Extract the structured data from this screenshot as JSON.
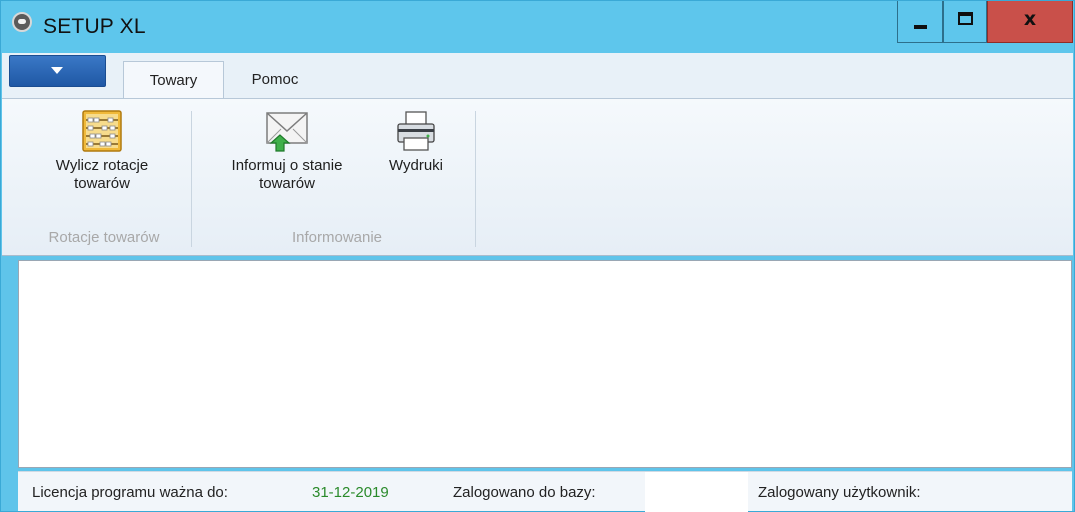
{
  "window": {
    "title": "SETUP XL",
    "close_glyph": "x"
  },
  "tabs": [
    {
      "label": "Towary",
      "active": true
    },
    {
      "label": "Pomoc",
      "active": false
    }
  ],
  "ribbon": {
    "groups": [
      {
        "label": "Rotacje towarów",
        "buttons": [
          {
            "label_line1": "Wylicz rotacje",
            "label_line2": "towarów",
            "icon": "abacus-icon"
          }
        ]
      },
      {
        "label": "Informowanie",
        "buttons": [
          {
            "label_line1": "Informuj o stanie",
            "label_line2": "towarów",
            "icon": "mail-upload-icon"
          },
          {
            "label_line1": "Wydruki",
            "label_line2": "",
            "icon": "printer-icon"
          }
        ]
      }
    ]
  },
  "statusbar": {
    "license_label": "Licencja programu ważna do:",
    "license_date": "31-12-2019",
    "database_label": "Zalogowano do bazy:",
    "database_value": "",
    "user_label": "Zalogowany użytkownik:",
    "user_value": ""
  },
  "colors": {
    "titlebar": "#5ec6ec",
    "close_button": "#c9504a",
    "app_menu": "#2a66b5",
    "license_date": "#2a8a2a",
    "group_label": "#a8a8a8"
  }
}
